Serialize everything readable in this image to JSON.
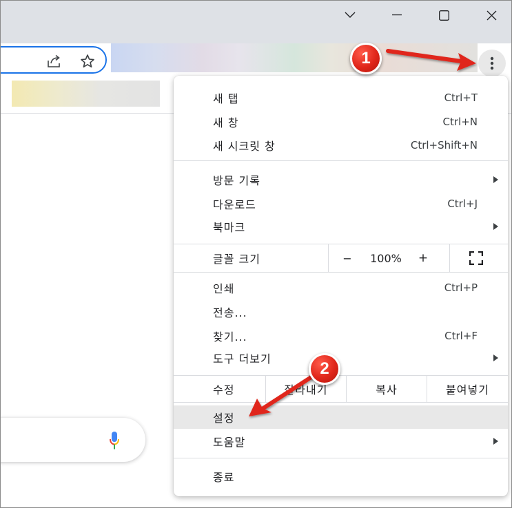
{
  "menu": {
    "new_tab": {
      "label": "새 탭",
      "shortcut": "Ctrl+T"
    },
    "new_window": {
      "label": "새 창",
      "shortcut": "Ctrl+N"
    },
    "new_incognito": {
      "label": "새 시크릿 창",
      "shortcut": "Ctrl+Shift+N"
    },
    "history": {
      "label": "방문 기록"
    },
    "downloads": {
      "label": "다운로드",
      "shortcut": "Ctrl+J"
    },
    "bookmarks": {
      "label": "북마크"
    },
    "zoom": {
      "label": "글꼴 크기",
      "minus": "−",
      "value": "100%",
      "plus": "+"
    },
    "print": {
      "label": "인쇄",
      "shortcut": "Ctrl+P"
    },
    "cast": {
      "label": "전송..."
    },
    "find": {
      "label": "찾기...",
      "shortcut": "Ctrl+F"
    },
    "more_tools": {
      "label": "도구 더보기"
    },
    "edit": {
      "label": "수정",
      "cut": "잘라내기",
      "copy": "복사",
      "paste": "붙여넣기"
    },
    "settings": {
      "label": "설정"
    },
    "help": {
      "label": "도움말"
    },
    "exit": {
      "label": "종료"
    }
  },
  "annotations": {
    "step1": "1",
    "step2": "2",
    "arrow_color": "#e0261a"
  },
  "colors": {
    "accent": "#1a73e8",
    "highlight": "#e8e8e8",
    "titlebar": "#dee1e6"
  }
}
